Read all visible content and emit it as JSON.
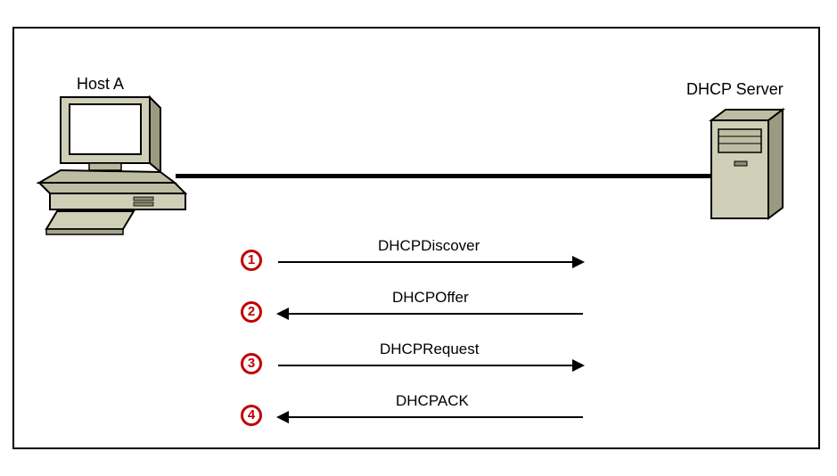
{
  "nodes": {
    "host": {
      "label": "Host A"
    },
    "server": {
      "label": "DHCP Server"
    }
  },
  "steps": [
    {
      "n": "1",
      "label": "DHCPDiscover",
      "dir": "right"
    },
    {
      "n": "2",
      "label": "DHCPOffer",
      "dir": "left"
    },
    {
      "n": "3",
      "label": "DHCPRequest",
      "dir": "right"
    },
    {
      "n": "4",
      "label": "DHCPACK",
      "dir": "left"
    }
  ]
}
